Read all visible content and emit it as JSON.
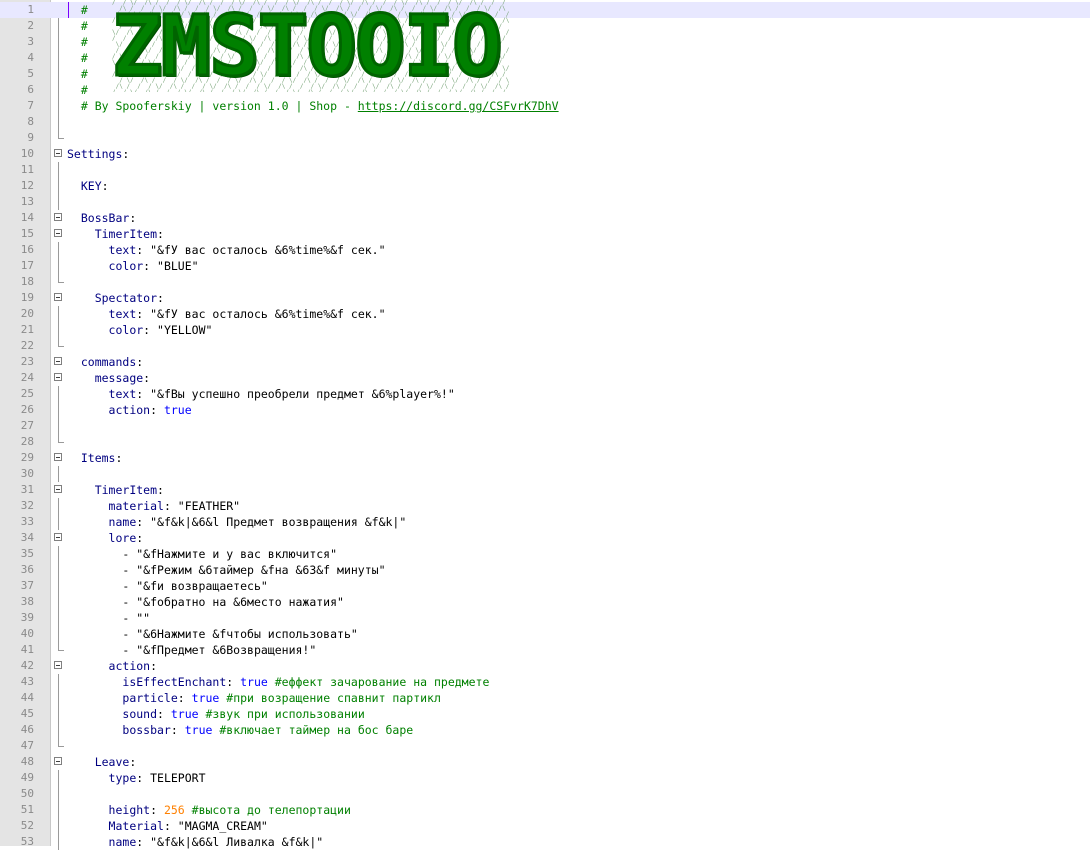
{
  "logo": {
    "text": "ZMSTOOIO"
  },
  "lines": [
    {
      "n": "1",
      "fold": "none",
      "current": true,
      "parts": [
        {
          "t": "  # ",
          "c": "c"
        }
      ]
    },
    {
      "n": "2",
      "fold": "line",
      "parts": [
        {
          "t": "  #",
          "c": "c"
        }
      ]
    },
    {
      "n": "3",
      "fold": "line",
      "parts": [
        {
          "t": "  #",
          "c": "c"
        }
      ]
    },
    {
      "n": "4",
      "fold": "line",
      "parts": [
        {
          "t": "  #",
          "c": "c"
        }
      ]
    },
    {
      "n": "5",
      "fold": "line",
      "parts": [
        {
          "t": "  #",
          "c": "c"
        }
      ]
    },
    {
      "n": "6",
      "fold": "line",
      "parts": [
        {
          "t": "  #",
          "c": "c"
        }
      ]
    },
    {
      "n": "7",
      "fold": "line",
      "parts": [
        {
          "t": "  # By Spooferskiy | version 1.0 | Shop - ",
          "c": "c"
        },
        {
          "t": "https://discord.gg/CSFvrK7DhV",
          "c": "link"
        }
      ]
    },
    {
      "n": "8",
      "fold": "line",
      "parts": []
    },
    {
      "n": "9",
      "fold": "end",
      "parts": []
    },
    {
      "n": "10",
      "fold": "box",
      "parts": [
        {
          "t": "Settings",
          "c": "k"
        },
        {
          "t": ":",
          "c": "p"
        }
      ]
    },
    {
      "n": "11",
      "fold": "line",
      "parts": []
    },
    {
      "n": "12",
      "fold": "line",
      "parts": [
        {
          "t": "  "
        },
        {
          "t": "KEY",
          "c": "k"
        },
        {
          "t": ":",
          "c": "p"
        }
      ]
    },
    {
      "n": "13",
      "fold": "line",
      "parts": []
    },
    {
      "n": "14",
      "fold": "box",
      "parts": [
        {
          "t": "  "
        },
        {
          "t": "BossBar",
          "c": "k"
        },
        {
          "t": ":",
          "c": "p"
        }
      ]
    },
    {
      "n": "15",
      "fold": "box",
      "parts": [
        {
          "t": "    "
        },
        {
          "t": "TimerItem",
          "c": "k"
        },
        {
          "t": ":",
          "c": "p"
        }
      ]
    },
    {
      "n": "16",
      "fold": "line",
      "parts": [
        {
          "t": "      "
        },
        {
          "t": "text",
          "c": "k"
        },
        {
          "t": ": ",
          "c": "p"
        },
        {
          "t": "\"&fУ вас осталось &6%time%&f сек.\"",
          "c": "s"
        }
      ]
    },
    {
      "n": "17",
      "fold": "line",
      "parts": [
        {
          "t": "      "
        },
        {
          "t": "color",
          "c": "k"
        },
        {
          "t": ": ",
          "c": "p"
        },
        {
          "t": "\"BLUE\"",
          "c": "s"
        }
      ]
    },
    {
      "n": "18",
      "fold": "end",
      "parts": []
    },
    {
      "n": "19",
      "fold": "box",
      "parts": [
        {
          "t": "    "
        },
        {
          "t": "Spectator",
          "c": "k"
        },
        {
          "t": ":",
          "c": "p"
        }
      ]
    },
    {
      "n": "20",
      "fold": "line",
      "parts": [
        {
          "t": "      "
        },
        {
          "t": "text",
          "c": "k"
        },
        {
          "t": ": ",
          "c": "p"
        },
        {
          "t": "\"&fУ вас осталось &6%time%&f сек.\"",
          "c": "s"
        }
      ]
    },
    {
      "n": "21",
      "fold": "line",
      "parts": [
        {
          "t": "      "
        },
        {
          "t": "color",
          "c": "k"
        },
        {
          "t": ": ",
          "c": "p"
        },
        {
          "t": "\"YELLOW\"",
          "c": "s"
        }
      ]
    },
    {
      "n": "22",
      "fold": "end",
      "parts": []
    },
    {
      "n": "23",
      "fold": "box",
      "parts": [
        {
          "t": "  "
        },
        {
          "t": "commands",
          "c": "k"
        },
        {
          "t": ":",
          "c": "p"
        }
      ]
    },
    {
      "n": "24",
      "fold": "box",
      "parts": [
        {
          "t": "    "
        },
        {
          "t": "message",
          "c": "k"
        },
        {
          "t": ":",
          "c": "p"
        }
      ]
    },
    {
      "n": "25",
      "fold": "line",
      "parts": [
        {
          "t": "      "
        },
        {
          "t": "text",
          "c": "k"
        },
        {
          "t": ": ",
          "c": "p"
        },
        {
          "t": "\"&fВы успешно преобрели предмет &6%player%!\"",
          "c": "s"
        }
      ]
    },
    {
      "n": "26",
      "fold": "line",
      "parts": [
        {
          "t": "      "
        },
        {
          "t": "action",
          "c": "k"
        },
        {
          "t": ": ",
          "c": "p"
        },
        {
          "t": "true",
          "c": "b"
        }
      ]
    },
    {
      "n": "27",
      "fold": "line",
      "parts": []
    },
    {
      "n": "28",
      "fold": "end",
      "parts": []
    },
    {
      "n": "29",
      "fold": "box",
      "parts": [
        {
          "t": "  "
        },
        {
          "t": "Items",
          "c": "k"
        },
        {
          "t": ":",
          "c": "p"
        }
      ]
    },
    {
      "n": "30",
      "fold": "line",
      "parts": []
    },
    {
      "n": "31",
      "fold": "box",
      "parts": [
        {
          "t": "    "
        },
        {
          "t": "TimerItem",
          "c": "k"
        },
        {
          "t": ":",
          "c": "p"
        }
      ]
    },
    {
      "n": "32",
      "fold": "line",
      "parts": [
        {
          "t": "      "
        },
        {
          "t": "material",
          "c": "k"
        },
        {
          "t": ": ",
          "c": "p"
        },
        {
          "t": "\"FEATHER\"",
          "c": "s"
        }
      ]
    },
    {
      "n": "33",
      "fold": "line",
      "parts": [
        {
          "t": "      "
        },
        {
          "t": "name",
          "c": "k"
        },
        {
          "t": ": ",
          "c": "p"
        },
        {
          "t": "\"&f&k|&6&l Предмет возвращения &f&k|\"",
          "c": "s"
        }
      ]
    },
    {
      "n": "34",
      "fold": "box",
      "parts": [
        {
          "t": "      "
        },
        {
          "t": "lore",
          "c": "k"
        },
        {
          "t": ":",
          "c": "p"
        }
      ]
    },
    {
      "n": "35",
      "fold": "line",
      "parts": [
        {
          "t": "        - ",
          "c": "p"
        },
        {
          "t": "\"&fНажмите и у вас включится\"",
          "c": "s"
        }
      ]
    },
    {
      "n": "36",
      "fold": "line",
      "parts": [
        {
          "t": "        - ",
          "c": "p"
        },
        {
          "t": "\"&fРежим &6таймер &fна &63&f минуты\"",
          "c": "s"
        }
      ]
    },
    {
      "n": "37",
      "fold": "line",
      "parts": [
        {
          "t": "        - ",
          "c": "p"
        },
        {
          "t": "\"&fи возвращаетесь\"",
          "c": "s"
        }
      ]
    },
    {
      "n": "38",
      "fold": "line",
      "parts": [
        {
          "t": "        - ",
          "c": "p"
        },
        {
          "t": "\"&fобратно на &6место нажатия\"",
          "c": "s"
        }
      ]
    },
    {
      "n": "39",
      "fold": "line",
      "parts": [
        {
          "t": "        - ",
          "c": "p"
        },
        {
          "t": "\"\"",
          "c": "s"
        }
      ]
    },
    {
      "n": "40",
      "fold": "line",
      "parts": [
        {
          "t": "        - ",
          "c": "p"
        },
        {
          "t": "\"&6Нажмите &fчтобы использовать\"",
          "c": "s"
        }
      ]
    },
    {
      "n": "41",
      "fold": "end",
      "parts": [
        {
          "t": "        - ",
          "c": "p"
        },
        {
          "t": "\"&fПредмет &6Возвращения!\"",
          "c": "s"
        }
      ]
    },
    {
      "n": "42",
      "fold": "box",
      "parts": [
        {
          "t": "      "
        },
        {
          "t": "action",
          "c": "k"
        },
        {
          "t": ":",
          "c": "p"
        }
      ]
    },
    {
      "n": "43",
      "fold": "line",
      "parts": [
        {
          "t": "        "
        },
        {
          "t": "isEffectEnchant",
          "c": "k"
        },
        {
          "t": ": ",
          "c": "p"
        },
        {
          "t": "true",
          "c": "b"
        },
        {
          "t": " #еффект зачарование на предмете",
          "c": "c"
        }
      ]
    },
    {
      "n": "44",
      "fold": "line",
      "parts": [
        {
          "t": "        "
        },
        {
          "t": "particle",
          "c": "k"
        },
        {
          "t": ": ",
          "c": "p"
        },
        {
          "t": "true",
          "c": "b"
        },
        {
          "t": " #при возращение спавнит партикл",
          "c": "c"
        }
      ]
    },
    {
      "n": "45",
      "fold": "line",
      "parts": [
        {
          "t": "        "
        },
        {
          "t": "sound",
          "c": "k"
        },
        {
          "t": ": ",
          "c": "p"
        },
        {
          "t": "true",
          "c": "b"
        },
        {
          "t": " #звук при использовании",
          "c": "c"
        }
      ]
    },
    {
      "n": "46",
      "fold": "line",
      "parts": [
        {
          "t": "        "
        },
        {
          "t": "bossbar",
          "c": "k"
        },
        {
          "t": ": ",
          "c": "p"
        },
        {
          "t": "true",
          "c": "b"
        },
        {
          "t": " #включает таймер на бос баре",
          "c": "c"
        }
      ]
    },
    {
      "n": "47",
      "fold": "end",
      "parts": []
    },
    {
      "n": "48",
      "fold": "box",
      "parts": [
        {
          "t": "    "
        },
        {
          "t": "Leave",
          "c": "k"
        },
        {
          "t": ":",
          "c": "p"
        }
      ]
    },
    {
      "n": "49",
      "fold": "line",
      "parts": [
        {
          "t": "      "
        },
        {
          "t": "type",
          "c": "k"
        },
        {
          "t": ": ",
          "c": "p"
        },
        {
          "t": "TELEPORT",
          "c": "p"
        }
      ]
    },
    {
      "n": "50",
      "fold": "line",
      "parts": []
    },
    {
      "n": "51",
      "fold": "line",
      "parts": [
        {
          "t": "      "
        },
        {
          "t": "height",
          "c": "k"
        },
        {
          "t": ": ",
          "c": "p"
        },
        {
          "t": "256",
          "c": "n"
        },
        {
          "t": " #высота до телепортации",
          "c": "c"
        }
      ]
    },
    {
      "n": "52",
      "fold": "line",
      "parts": [
        {
          "t": "      "
        },
        {
          "t": "Material",
          "c": "k"
        },
        {
          "t": ": ",
          "c": "p"
        },
        {
          "t": "\"MAGMA_CREAM\"",
          "c": "s"
        }
      ]
    },
    {
      "n": "53",
      "fold": "line",
      "parts": [
        {
          "t": "      "
        },
        {
          "t": "name",
          "c": "k"
        },
        {
          "t": ": ",
          "c": "p"
        },
        {
          "t": "\"&f&k|&6&l Ливалка &f&k|\"",
          "c": "s"
        }
      ]
    }
  ]
}
